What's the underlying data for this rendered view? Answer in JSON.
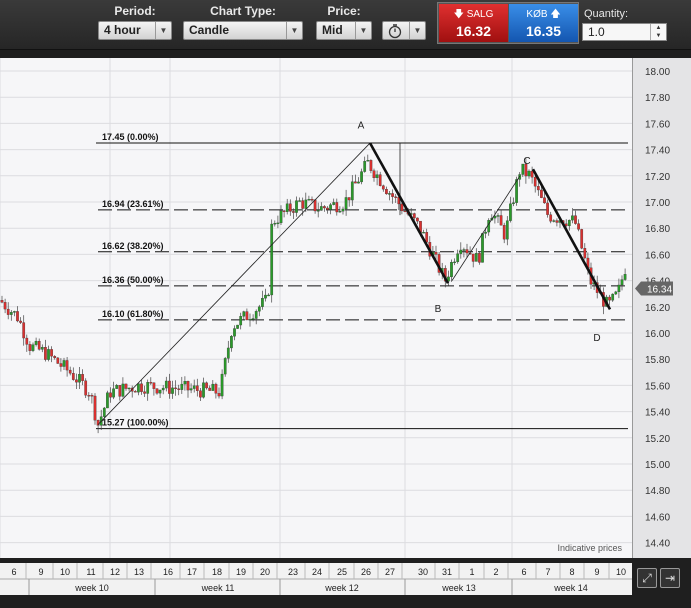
{
  "toolbar": {
    "period": {
      "label": "Period:",
      "value": "4 hour"
    },
    "chart_type": {
      "label": "Chart Type:",
      "value": "Candle"
    },
    "price": {
      "label": "Price:",
      "value": "Mid"
    },
    "quote": {
      "sell_label": "SALG",
      "sell_price": "16.32",
      "buy_label": "KØB",
      "buy_price": "16.35"
    },
    "quantity": {
      "label": "Quantity:",
      "value": "1.0"
    }
  },
  "colors": {
    "up": "#2a9a2a",
    "down": "#d83030",
    "grid": "#dcdce0"
  },
  "chart_data": {
    "type": "candlestick",
    "ylim": [
      14.3,
      18.1
    ],
    "yticks": [
      "18.00",
      "17.80",
      "17.60",
      "17.40",
      "17.20",
      "17.00",
      "16.80",
      "16.60",
      "16.40",
      "16.20",
      "16.00",
      "15.80",
      "15.60",
      "15.40",
      "15.20",
      "15.00",
      "14.80",
      "14.60",
      "14.40"
    ],
    "current_price": "16.34",
    "indicative": "Indicative prices",
    "fib_levels": [
      {
        "value": 17.45,
        "label": "17.45 (0.00%)",
        "solid": true
      },
      {
        "value": 16.94,
        "label": "16.94 (23.61%)",
        "solid": false
      },
      {
        "value": 16.62,
        "label": "16.62 (38.20%)",
        "solid": false
      },
      {
        "value": 16.36,
        "label": "16.36 (50.00%)",
        "solid": false
      },
      {
        "value": 16.1,
        "label": "16.10 (61.80%)",
        "solid": false
      },
      {
        "value": 15.27,
        "label": "15.27 (100.00%)",
        "solid": true
      }
    ],
    "points": [
      {
        "name": "A",
        "label": "A"
      },
      {
        "name": "B",
        "label": "B"
      },
      {
        "name": "C",
        "label": "C"
      },
      {
        "name": "D",
        "label": "D"
      }
    ],
    "days": [
      "6",
      "9",
      "10",
      "11",
      "12",
      "13",
      "16",
      "17",
      "18",
      "19",
      "20",
      "23",
      "24",
      "25",
      "26",
      "27",
      "30",
      "31",
      "1",
      "2",
      "6",
      "7",
      "8",
      "9",
      "10"
    ],
    "weeks": [
      "week 10",
      "week 11",
      "week 12",
      "week 13",
      "week 14"
    ]
  }
}
